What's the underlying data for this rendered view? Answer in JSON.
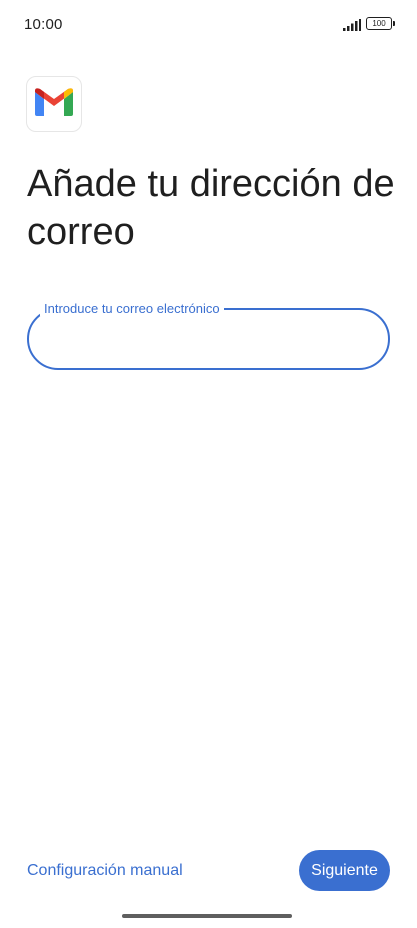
{
  "status_bar": {
    "time": "10:00",
    "battery_level": "100",
    "signal_icon": "signal-bars-icon",
    "battery_icon": "battery-icon"
  },
  "logo": {
    "icon": "gmail-logo-icon",
    "colors": {
      "blue": "#4285F4",
      "red": "#EA4335",
      "yellow": "#FBBC04",
      "green": "#34A853",
      "dark_red": "#C5221F"
    }
  },
  "page": {
    "title": "Añade tu dirección de correo"
  },
  "email_field": {
    "label": "Introduce tu correo electrónico",
    "value": "",
    "state": "focused"
  },
  "actions": {
    "manual_config_label": "Configuración manual",
    "next_label": "Siguiente"
  },
  "colors": {
    "accent": "#3a6fd0",
    "text": "#1f1f1f",
    "background": "#ffffff"
  }
}
